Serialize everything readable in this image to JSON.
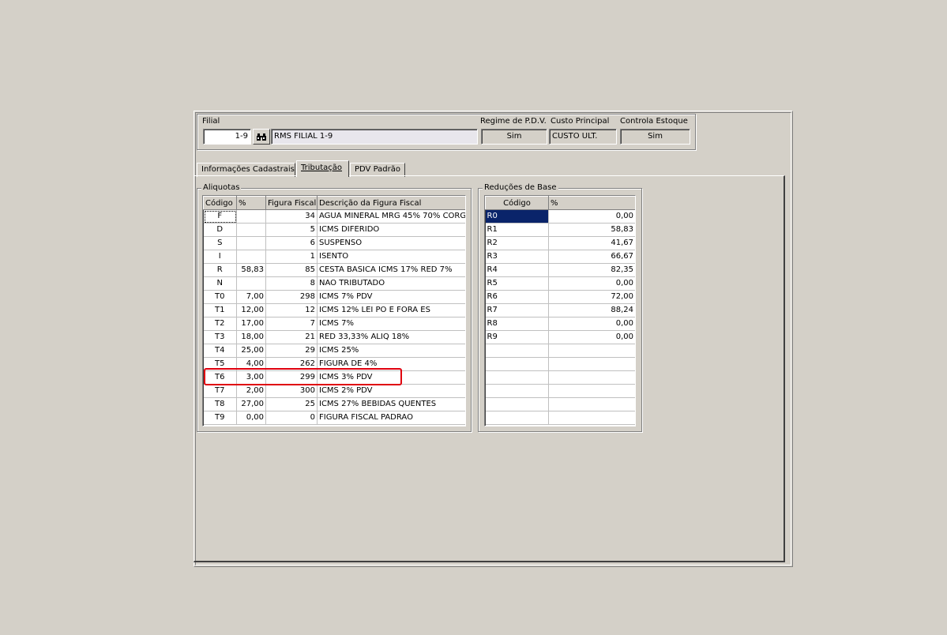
{
  "header": {
    "filial_label": "Filial",
    "filial_code": "1-9",
    "filial_name": "RMS FILIAL 1-9",
    "regime_label": "Regime de P.D.V.",
    "regime_value": "Sim",
    "custo_label": "Custo Principal",
    "custo_value": "CUSTO ULT.",
    "estoque_label": "Controla Estoque",
    "estoque_value": "Sim",
    "search_icon": "binoculars-icon"
  },
  "tabs": [
    {
      "label": "Informações Cadastrais"
    },
    {
      "label": "Tributação",
      "active": true
    },
    {
      "label": "PDV Padrão"
    }
  ],
  "aliquotas": {
    "title": "Aliquotas",
    "columns": [
      "Código",
      "%",
      "Figura Fiscal",
      "Descrição da Figura Fiscal"
    ],
    "rows": [
      [
        "F",
        "",
        "34",
        "AGUA MINERAL MRG 45% 70% CORG"
      ],
      [
        "D",
        "",
        "5",
        "ICMS DIFERIDO"
      ],
      [
        "S",
        "",
        "6",
        "SUSPENSO"
      ],
      [
        "I",
        "",
        "1",
        "ISENTO"
      ],
      [
        "R",
        "58,83",
        "85",
        "CESTA BASICA ICMS 17% RED 7%"
      ],
      [
        "N",
        "",
        "8",
        "NAO TRIBUTADO"
      ],
      [
        "T0",
        "7,00",
        "298",
        "ICMS 7% PDV"
      ],
      [
        "T1",
        "12,00",
        "12",
        "ICMS 12% LEI PO  E FORA ES"
      ],
      [
        "T2",
        "17,00",
        "7",
        "ICMS 7%"
      ],
      [
        "T3",
        "18,00",
        "21",
        "RED 33,33%  ALIQ 18%"
      ],
      [
        "T4",
        "25,00",
        "29",
        "ICMS 25%"
      ],
      [
        "T5",
        "4,00",
        "262",
        "FIGURA DE 4%"
      ],
      [
        "T6",
        "3,00",
        "299",
        "ICMS 3% PDV"
      ],
      [
        "T7",
        "2,00",
        "300",
        "ICMS 2% PDV"
      ],
      [
        "T8",
        "27,00",
        "25",
        "ICMS 27% BEBIDAS QUENTES"
      ],
      [
        "T9",
        "0,00",
        "0",
        "FIGURA FISCAL PADRAO"
      ]
    ]
  },
  "reducoes": {
    "title": "Reduções de Base",
    "columns": [
      "Código",
      "%"
    ],
    "rows": [
      [
        "R0",
        "0,00"
      ],
      [
        "R1",
        "58,83"
      ],
      [
        "R2",
        "41,67"
      ],
      [
        "R3",
        "66,67"
      ],
      [
        "R4",
        "82,35"
      ],
      [
        "R5",
        "0,00"
      ],
      [
        "R6",
        "72,00"
      ],
      [
        "R7",
        "88,24"
      ],
      [
        "R8",
        "0,00"
      ],
      [
        "R9",
        "0,00"
      ]
    ],
    "empty_rows": 6
  },
  "highlight_color": "#e0000e",
  "selection_color": "#0a246a"
}
